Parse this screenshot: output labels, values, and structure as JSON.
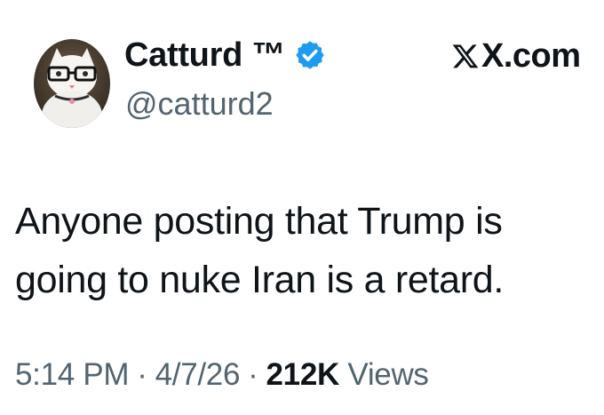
{
  "author": {
    "display_name": "Catturd ™",
    "handle": "@catturd2",
    "verified": true,
    "avatar_icon": "cat-with-glasses-avatar"
  },
  "source": {
    "icon": "x-logo-icon",
    "label": "X.com"
  },
  "tweet": {
    "line1": "Anyone posting that Trump is",
    "line2": "going to nuke Iran is a retard."
  },
  "meta": {
    "time": "5:14 PM",
    "separator": "·",
    "date": "4/7/26",
    "views_count": "212K",
    "views_label": "Views"
  },
  "colors": {
    "text": "#0f1419",
    "secondary": "#536471",
    "verified_blue": "#1d9bf0"
  }
}
